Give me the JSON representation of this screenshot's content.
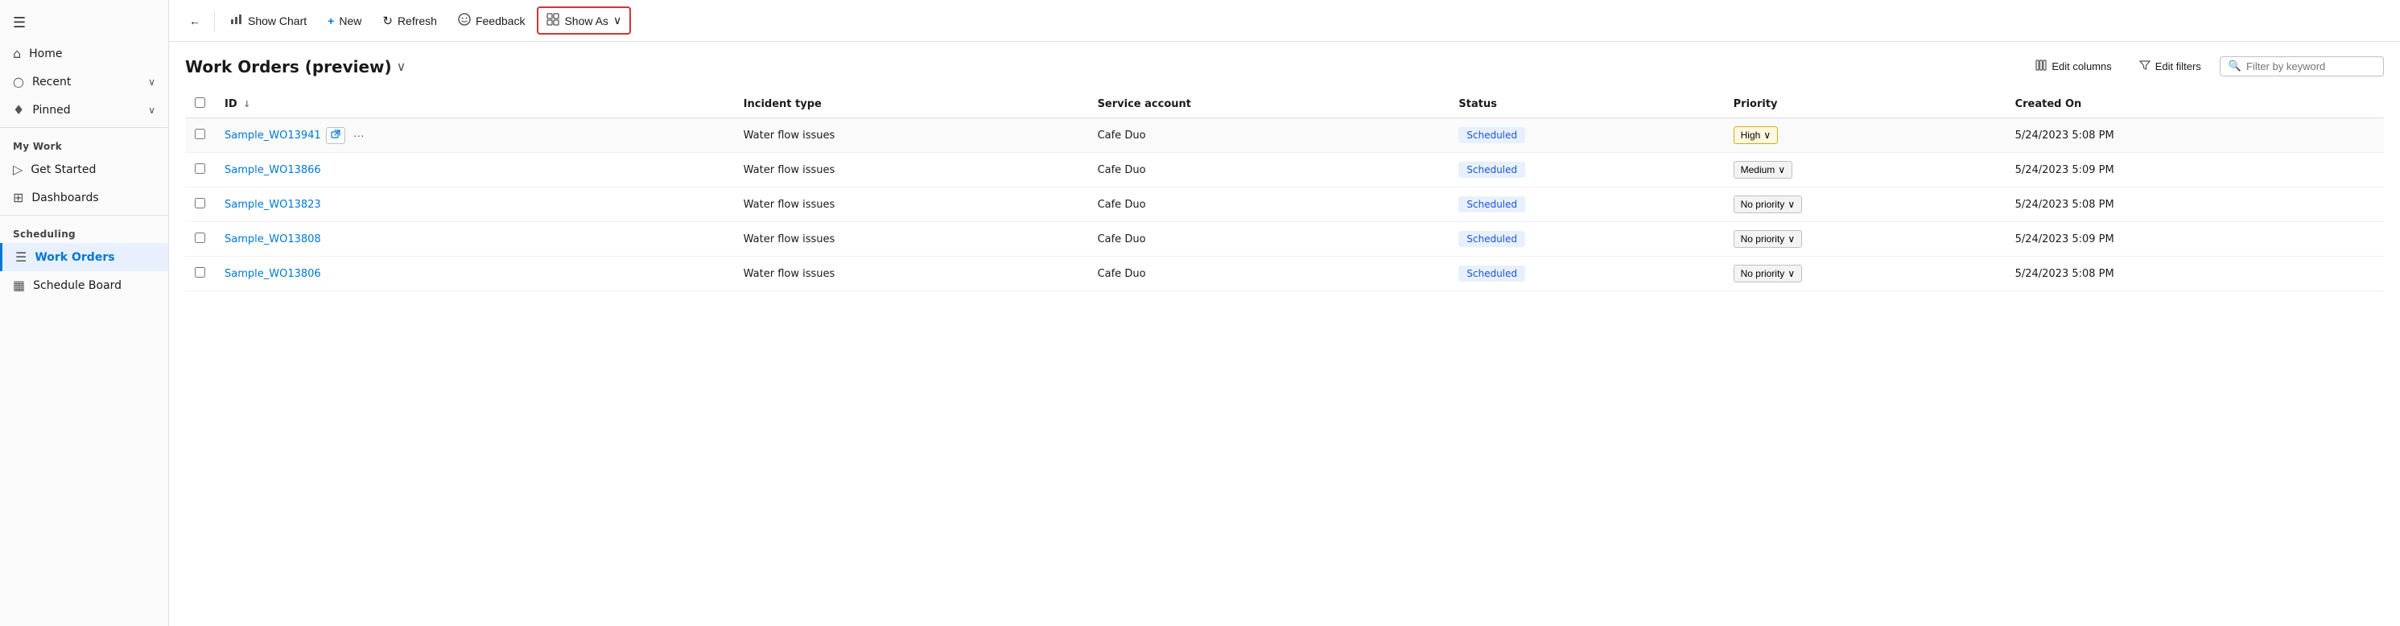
{
  "sidebar": {
    "hamburger_icon": "☰",
    "nav_items": [
      {
        "id": "home",
        "label": "Home",
        "icon": "⌂",
        "has_chevron": false
      },
      {
        "id": "recent",
        "label": "Recent",
        "icon": "○",
        "has_chevron": true
      },
      {
        "id": "pinned",
        "label": "Pinned",
        "icon": "♦",
        "has_chevron": true
      }
    ],
    "my_work_label": "My Work",
    "my_work_items": [
      {
        "id": "get-started",
        "label": "Get Started",
        "icon": "▷"
      },
      {
        "id": "dashboards",
        "label": "Dashboards",
        "icon": "⊞"
      }
    ],
    "scheduling_label": "Scheduling",
    "scheduling_items": [
      {
        "id": "work-orders",
        "label": "Work Orders",
        "icon": "☰",
        "active": true
      },
      {
        "id": "schedule-board",
        "label": "Schedule Board",
        "icon": "▦"
      }
    ]
  },
  "toolbar": {
    "back_icon": "←",
    "show_chart_label": "Show Chart",
    "show_chart_icon": "📊",
    "new_label": "New",
    "new_icon": "+",
    "refresh_label": "Refresh",
    "refresh_icon": "↻",
    "feedback_label": "Feedback",
    "feedback_icon": "☺",
    "show_as_label": "Show As",
    "show_as_icon": "⊞",
    "show_as_chevron": "∨"
  },
  "content": {
    "title": "Work Orders (preview)",
    "title_chevron": "∨",
    "edit_columns_label": "Edit columns",
    "edit_columns_icon": "⊟",
    "edit_filters_label": "Edit filters",
    "edit_filters_icon": "⧩",
    "filter_placeholder": "Filter by keyword",
    "filter_icon": "🔍"
  },
  "table": {
    "columns": [
      {
        "id": "id",
        "label": "ID",
        "sort_icon": "↓"
      },
      {
        "id": "incident_type",
        "label": "Incident type"
      },
      {
        "id": "service_account",
        "label": "Service account"
      },
      {
        "id": "status",
        "label": "Status"
      },
      {
        "id": "priority",
        "label": "Priority"
      },
      {
        "id": "created_on",
        "label": "Created On"
      }
    ],
    "rows": [
      {
        "id": "Sample_WO13941",
        "incident_type": "Water flow issues",
        "service_account": "Cafe Duo",
        "status": "Scheduled",
        "priority": "High",
        "priority_type": "high",
        "created_on": "5/24/2023 5:08 PM",
        "highlighted": true
      },
      {
        "id": "Sample_WO13866",
        "incident_type": "Water flow issues",
        "service_account": "Cafe Duo",
        "status": "Scheduled",
        "priority": "Medium",
        "priority_type": "medium",
        "created_on": "5/24/2023 5:09 PM",
        "highlighted": false
      },
      {
        "id": "Sample_WO13823",
        "incident_type": "Water flow issues",
        "service_account": "Cafe Duo",
        "status": "Scheduled",
        "priority": "No priority",
        "priority_type": "none",
        "created_on": "5/24/2023 5:08 PM",
        "highlighted": false
      },
      {
        "id": "Sample_WO13808",
        "incident_type": "Water flow issues",
        "service_account": "Cafe Duo",
        "status": "Scheduled",
        "priority": "No priority",
        "priority_type": "none",
        "created_on": "5/24/2023 5:09 PM",
        "highlighted": false
      },
      {
        "id": "Sample_WO13806",
        "incident_type": "Water flow issues",
        "service_account": "Cafe Duo",
        "status": "Scheduled",
        "priority": "No priority",
        "priority_type": "none",
        "created_on": "5/24/2023 5:08 PM",
        "highlighted": false
      }
    ]
  }
}
